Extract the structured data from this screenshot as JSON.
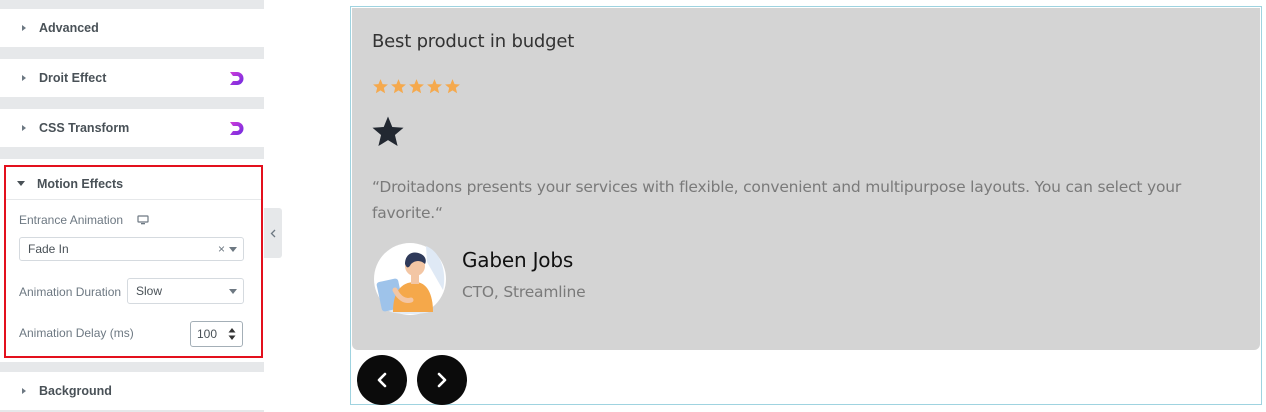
{
  "panel": {
    "sections": {
      "advanced": "Advanced",
      "droit_effect": "Droit Effect",
      "css_transform": "CSS Transform",
      "motion_effects": "Motion Effects",
      "background": "Background"
    },
    "motion": {
      "entrance_label": "Entrance Animation",
      "entrance_value": "Fade In",
      "duration_label": "Animation Duration",
      "duration_value": "Slow",
      "delay_label": "Animation Delay (ms)",
      "delay_value": "100"
    }
  },
  "testimonial": {
    "title": "Best product in budget",
    "rating": 5,
    "rating_max": 5,
    "quote": "“Droitadons presents your services with flexible, convenient and multipurpose layouts. You can select your favorite.“",
    "author_name": "Gaben Jobs",
    "author_role": "CTO, Streamline"
  },
  "colors": {
    "star": "#f5a94d",
    "card_bg": "#d4d4d4",
    "highlight": "#e3101d",
    "droit_logo": "#a12bd9"
  },
  "icons": {
    "prev": "chevron-left-icon",
    "next": "chevron-right-icon",
    "responsive": "desktop-icon"
  }
}
